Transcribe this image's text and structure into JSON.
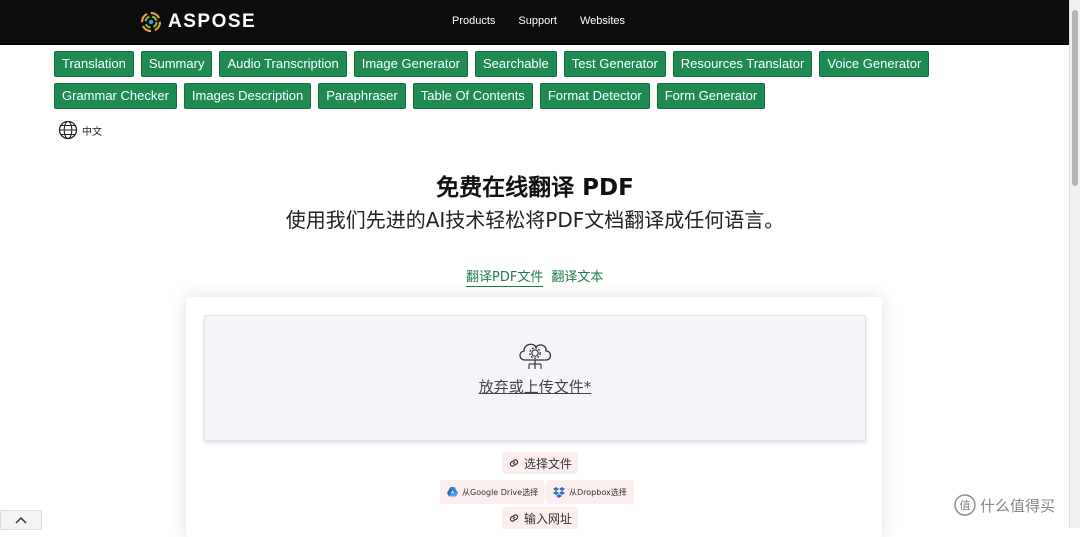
{
  "header": {
    "logo_text": "ASPOSE",
    "nav": [
      "Products",
      "Support",
      "Websites"
    ]
  },
  "tools": {
    "row1": [
      "Translation",
      "Summary",
      "Audio Transcription",
      "Image Generator",
      "Searchable",
      "Test Generator",
      "Resources Translator",
      "Voice Generator"
    ],
    "row2": [
      "Grammar Checker",
      "Images Description",
      "Paraphraser",
      "Table Of Contents",
      "Format Detector",
      "Form Generator"
    ]
  },
  "language": {
    "label": "中文",
    "icon": "globe-icon"
  },
  "hero": {
    "title": "免费在线翻译 PDF",
    "subtitle": "使用我们先进的AI技术轻松将PDF文档翻译成任何语言。"
  },
  "tabs": [
    {
      "label": "翻译PDF文件",
      "active": true
    },
    {
      "label": "翻译文本",
      "active": false
    }
  ],
  "upload": {
    "dropzone_text": "放弃或上传文件*",
    "choose_file": "选择文件",
    "google_drive": "从Google Drive选择",
    "dropbox": "从Dropbox选择",
    "enter_url": "输入网址"
  },
  "watermark": {
    "text": "什么值得买"
  },
  "colors": {
    "accent": "#1f8a53",
    "topbar": "#0d0d0d"
  }
}
